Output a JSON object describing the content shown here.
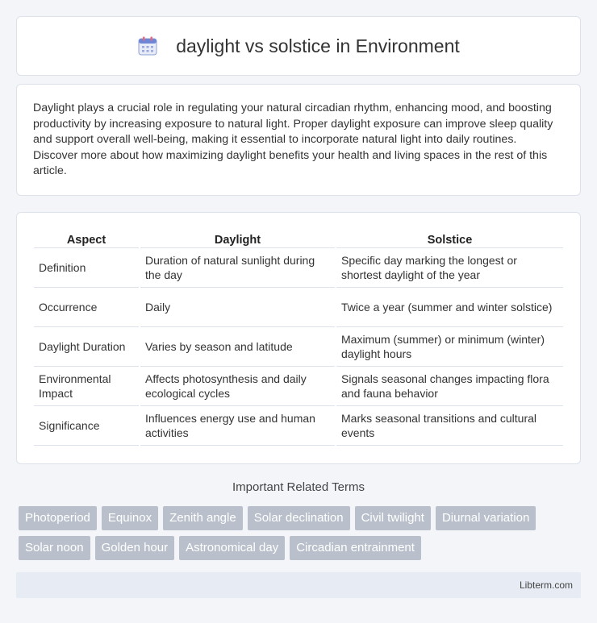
{
  "header": {
    "title": "daylight vs solstice in Environment",
    "icon": "calendar-icon"
  },
  "intro": {
    "text": "Daylight plays a crucial role in regulating your natural circadian rhythm, enhancing mood, and boosting productivity by increasing exposure to natural light. Proper daylight exposure can improve sleep quality and support overall well-being, making it essential to incorporate natural light into daily routines. Discover more about how maximizing daylight benefits your health and living spaces in the rest of this article."
  },
  "table": {
    "headers": [
      "Aspect",
      "Daylight",
      "Solstice"
    ],
    "rows": [
      [
        "Definition",
        "Duration of natural sunlight during the day",
        "Specific day marking the longest or shortest daylight of the year"
      ],
      [
        "Occurrence",
        "Daily",
        "Twice a year (summer and winter solstice)"
      ],
      [
        "Daylight Duration",
        "Varies by season and latitude",
        "Maximum (summer) or minimum (winter) daylight hours"
      ],
      [
        "Environmental Impact",
        "Affects photosynthesis and daily ecological cycles",
        "Signals seasonal changes impacting flora and fauna behavior"
      ],
      [
        "Significance",
        "Influences energy use and human activities",
        "Marks seasonal transitions and cultural events"
      ]
    ]
  },
  "related": {
    "title": "Important Related Terms",
    "tags": [
      "Photoperiod",
      "Equinox",
      "Zenith angle",
      "Solar declination",
      "Civil twilight",
      "Diurnal variation",
      "Solar noon",
      "Golden hour",
      "Astronomical day",
      "Circadian entrainment"
    ]
  },
  "footer": {
    "site": "Libterm.com"
  },
  "colors": {
    "background": "#f3f5f9",
    "tag_bg": "#b9c0cb",
    "footer_bg": "#e6ebf4"
  }
}
